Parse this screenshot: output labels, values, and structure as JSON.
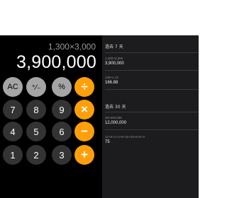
{
  "display": {
    "expression": "1,300×3,000",
    "result": "3,900,000"
  },
  "keys": {
    "ac": "AC",
    "plus_minus": "⁺∕₋",
    "percent": "%",
    "divide": "÷",
    "n7": "7",
    "n8": "8",
    "n9": "9",
    "multiply": "×",
    "n4": "4",
    "n5": "5",
    "n6": "6",
    "minus": "−",
    "n1": "1",
    "n2": "2",
    "n3": "3",
    "plus": "+"
  },
  "history": {
    "sections": [
      {
        "title": "過去 7 天",
        "entries": [
          {
            "expression": "1,300×3,000",
            "result": "3,900,000"
          },
          {
            "expression": "149+1.12",
            "result": "166.88"
          }
        ]
      },
      {
        "title": "過去 30 天",
        "entries": [
          {
            "expression": "30×400,000",
            "result": "12,000,000"
          },
          {
            "expression": "12+6+1+1+6+10+23+6+5+2",
            "result": "75"
          }
        ]
      }
    ]
  },
  "colors": {
    "operator": "#ff9f0a",
    "function_key": "#a5a5a5",
    "digit_key": "#333333",
    "calculator_bg": "#000000",
    "history_bg": "#1c1c1e"
  }
}
